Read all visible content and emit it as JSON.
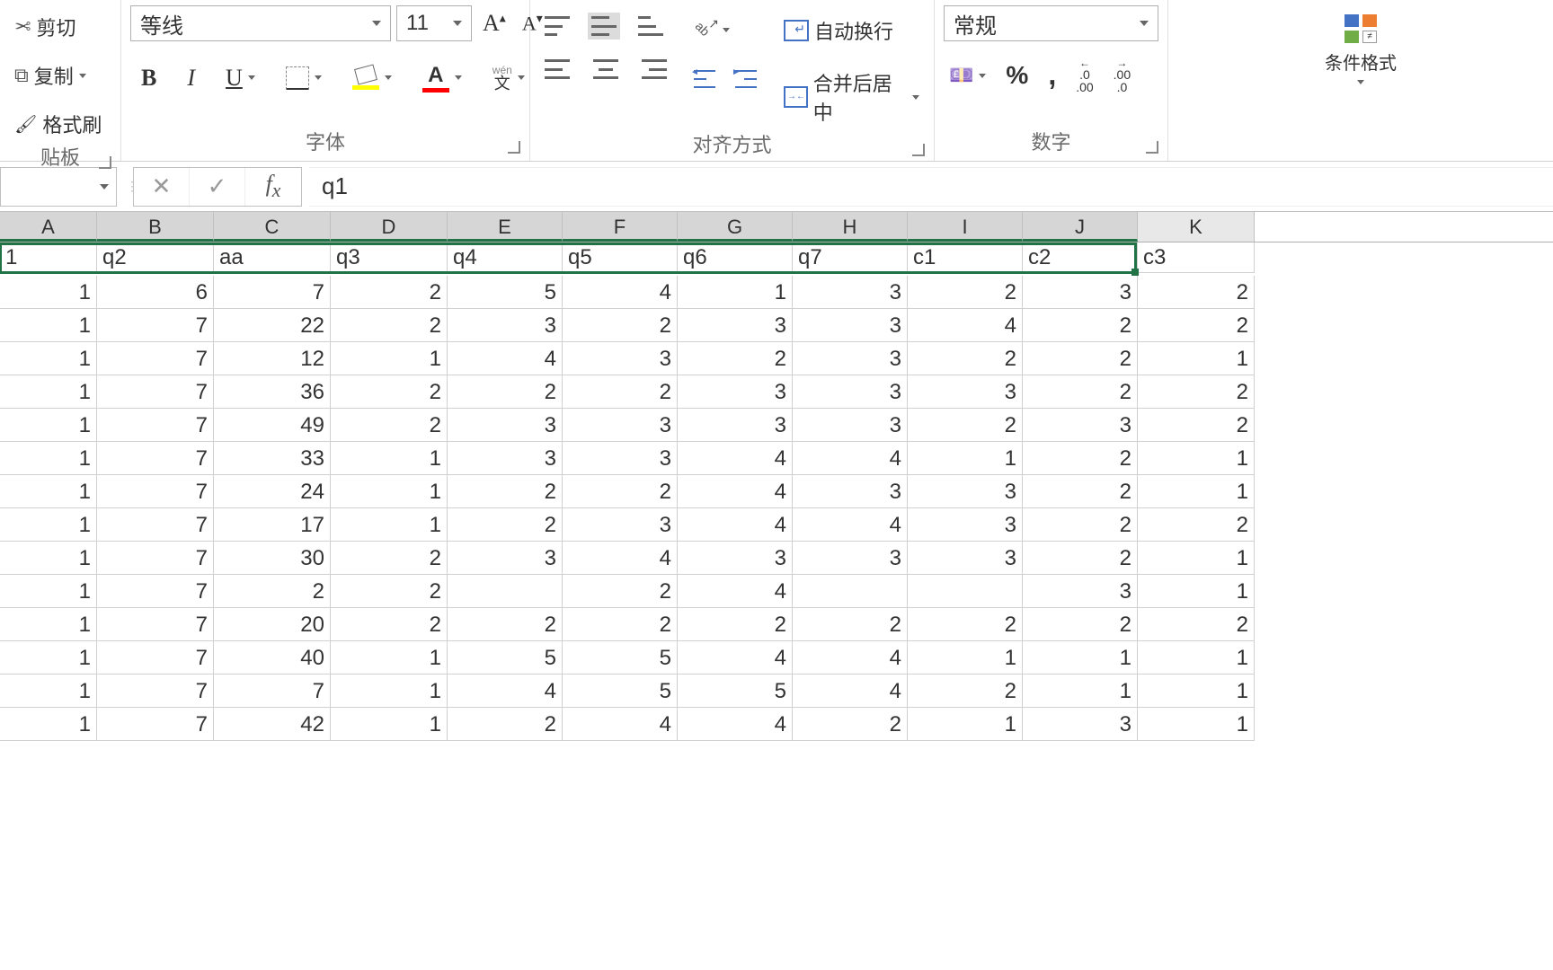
{
  "ribbon": {
    "clipboard": {
      "cut": "剪切",
      "copy": "复制",
      "brush": "格式刷",
      "label": "贴板"
    },
    "font": {
      "name": "等线",
      "size": "11",
      "wen_top": "wén",
      "wen_bot": "文",
      "label": "字体"
    },
    "align": {
      "wrap": "自动换行",
      "merge": "合并后居中",
      "label": "对齐方式"
    },
    "number": {
      "format": "常规",
      "dec1a": ".0",
      "dec1b": ".00",
      "dec2a": ".00",
      "dec2b": ".0",
      "label": "数字"
    },
    "condfmt": {
      "label": "条件格式",
      "ne": "≠"
    }
  },
  "fx": {
    "content": "q1"
  },
  "grid": {
    "cols": [
      "A",
      "B",
      "C",
      "D",
      "E",
      "F",
      "G",
      "H",
      "I",
      "J",
      "K"
    ],
    "headers": [
      "1",
      "q2",
      "aa",
      "q3",
      "q4",
      "q5",
      "q6",
      "q7",
      "c1",
      "c2",
      "c3"
    ],
    "rows": [
      [
        1,
        6,
        7,
        2,
        5,
        4,
        1,
        3,
        2,
        3,
        2
      ],
      [
        1,
        7,
        22,
        2,
        3,
        2,
        3,
        3,
        4,
        2,
        2
      ],
      [
        1,
        7,
        12,
        1,
        4,
        3,
        2,
        3,
        2,
        2,
        1
      ],
      [
        1,
        7,
        36,
        2,
        2,
        2,
        3,
        3,
        3,
        2,
        2
      ],
      [
        1,
        7,
        49,
        2,
        3,
        3,
        3,
        3,
        2,
        3,
        2
      ],
      [
        1,
        7,
        33,
        1,
        3,
        3,
        4,
        4,
        1,
        2,
        1
      ],
      [
        1,
        7,
        24,
        1,
        2,
        2,
        4,
        3,
        3,
        2,
        1
      ],
      [
        1,
        7,
        17,
        1,
        2,
        3,
        4,
        4,
        3,
        2,
        2
      ],
      [
        1,
        7,
        30,
        2,
        3,
        4,
        3,
        3,
        3,
        2,
        1
      ],
      [
        1,
        7,
        2,
        2,
        "",
        2,
        4,
        "",
        "",
        3,
        1
      ],
      [
        1,
        7,
        20,
        2,
        2,
        2,
        2,
        2,
        2,
        2,
        2
      ],
      [
        1,
        7,
        40,
        1,
        5,
        5,
        4,
        4,
        1,
        1,
        1
      ],
      [
        1,
        7,
        7,
        1,
        4,
        5,
        5,
        4,
        2,
        1,
        1
      ],
      [
        1,
        7,
        42,
        1,
        2,
        4,
        4,
        2,
        1,
        3,
        1
      ]
    ]
  }
}
